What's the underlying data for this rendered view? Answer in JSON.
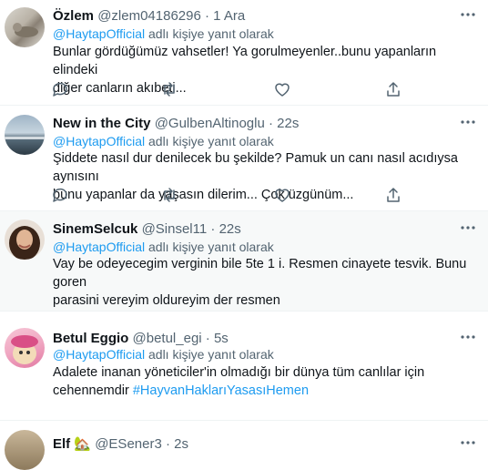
{
  "reply_prefix_word": "adlı kişiye yanıt olarak",
  "tweets": [
    {
      "name": "Özlem",
      "handle": "@zlem04186296",
      "sep": "·",
      "time": "1 Ara",
      "reply_to": "@HaytapOfficial",
      "lines": [
        "Bunlar gördüğümüz vahsetler! Ya gorulmeyenler..bunu yapanların elindeki",
        "diğer canların akıbeti..."
      ]
    },
    {
      "name": "New in the City",
      "handle": "@GulbenAltinoglu",
      "sep": "·",
      "time": "22s",
      "reply_to": "@HaytapOfficial",
      "lines": [
        "Şiddete nasıl dur denilecek bu şekilde?  Pamuk un canı nasıl acıdıysa aynısını",
        "bunu yapanlar da yaşasın dilerim...  Çok üzgünüm..."
      ]
    },
    {
      "name": "SinemSelcuk",
      "handle": "@Sinsel11",
      "sep": "·",
      "time": "22s",
      "reply_to": "@HaytapOfficial",
      "lines": [
        "Vay be odeyecegim verginin bile 5te 1 i. Resmen cinayete tesvik. Bunu goren",
        "parasini vereyim oldureyim der resmen"
      ]
    },
    {
      "name": "Betul Eggio",
      "handle": "@betul_egi",
      "sep": "·",
      "time": "5s",
      "reply_to": "@HaytapOfficial",
      "lines": [
        "Adalete inanan yöneticiler'in olmadığı bir dünya tüm canlılar için"
      ],
      "line2_plain": "cehennemdir ",
      "line2_tag": "#HayvanHaklarıYasasıHemen"
    },
    {
      "name": "Elf",
      "name_emoji": "🏡",
      "handle": "@ESener3",
      "sep": "·",
      "time": "2s"
    }
  ],
  "icons": {
    "reply": "reply-icon",
    "retweet": "retweet-icon",
    "like": "like-icon",
    "share": "share-icon",
    "more": "more-icon"
  },
  "colors": {
    "link": "#1d9bf0",
    "muted": "#536471",
    "highlight_bg": "#f7f9f9"
  }
}
